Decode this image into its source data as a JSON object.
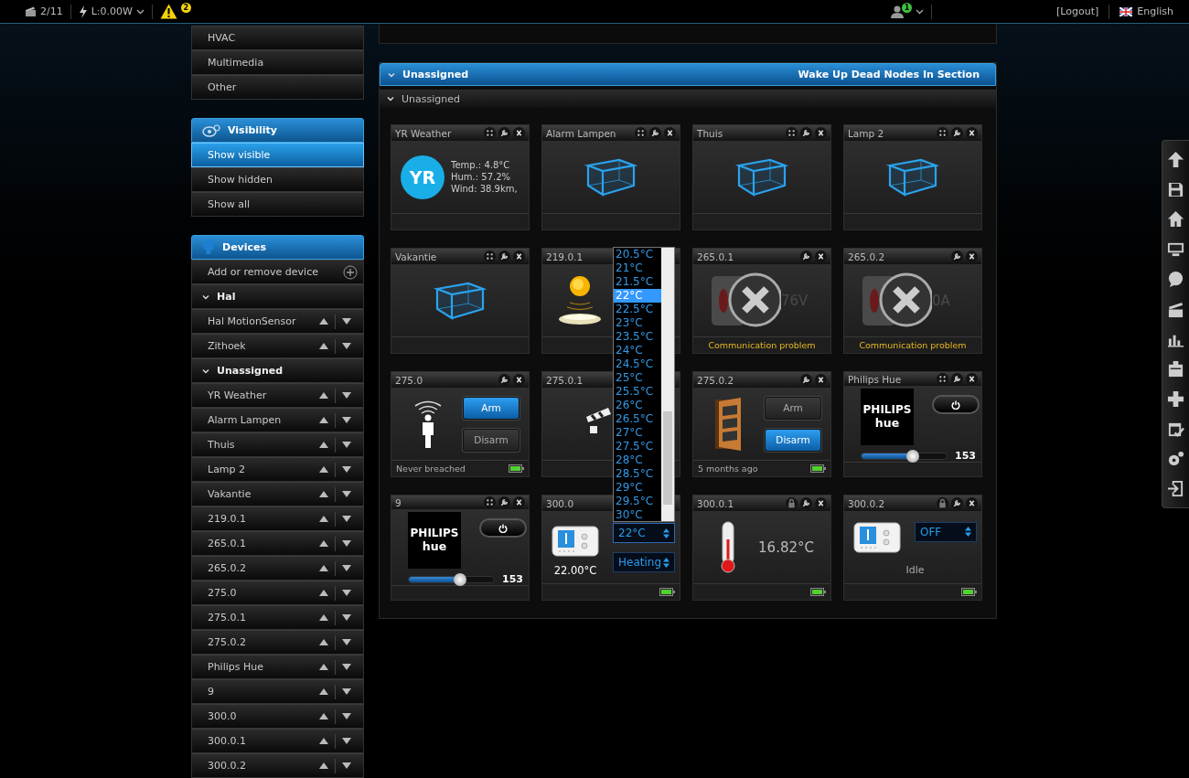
{
  "top_bar": {
    "scenes": "2/11",
    "power": "L:0.00W",
    "alerts": "2",
    "users": "1",
    "logout": "[Logout]",
    "language": "English"
  },
  "sidebar": {
    "menu": [
      {
        "label": "HVAC"
      },
      {
        "label": "Multimedia"
      },
      {
        "label": "Other"
      }
    ],
    "visibility": {
      "title": "Visibility",
      "items": [
        {
          "label": "Show visible",
          "selected": true
        },
        {
          "label": "Show hidden",
          "selected": false
        },
        {
          "label": "Show all",
          "selected": false
        }
      ]
    },
    "devices": {
      "title": "Devices",
      "add": "Add or remove device",
      "tree": [
        {
          "label": "Hal",
          "expanded": true,
          "children": [
            {
              "label": "Hal MotionSensor"
            },
            {
              "label": "Zithoek"
            }
          ]
        },
        {
          "label": "Unassigned",
          "expanded": true,
          "children": [
            {
              "label": "YR Weather"
            },
            {
              "label": "Alarm Lampen"
            },
            {
              "label": "Thuis"
            },
            {
              "label": "Lamp 2"
            },
            {
              "label": "Vakantie"
            },
            {
              "label": "219.0.1"
            },
            {
              "label": "265.0.1"
            },
            {
              "label": "265.0.2"
            },
            {
              "label": "275.0"
            },
            {
              "label": "275.0.1"
            },
            {
              "label": "275.0.2"
            },
            {
              "label": "Philips Hue"
            },
            {
              "label": "9"
            },
            {
              "label": "300.0"
            },
            {
              "label": "300.0.1"
            },
            {
              "label": "300.0.2"
            }
          ]
        }
      ]
    }
  },
  "panel": {
    "title": "Unassigned",
    "expanded": true,
    "action": "Wake Up Dead Nodes In Section",
    "subsection": {
      "label": "Unassigned",
      "expanded": true
    },
    "cards": [
      {
        "title": "YR Weather",
        "kind": "weather",
        "buttons": [
          {
            "kind": "move"
          },
          {
            "kind": "settings"
          },
          {
            "kind": "close"
          }
        ],
        "logo": "YR",
        "lines": [
          "Temp.: 4.8°C",
          "Hum.: 57.2%",
          "Wind: 38.9km,"
        ]
      },
      {
        "title": "Alarm Lampen",
        "kind": "scene",
        "buttons": [
          {
            "kind": "move"
          },
          {
            "kind": "settings"
          },
          {
            "kind": "close"
          }
        ]
      },
      {
        "title": "Thuis",
        "kind": "scene",
        "buttons": [
          {
            "kind": "move"
          },
          {
            "kind": "settings"
          },
          {
            "kind": "close"
          }
        ]
      },
      {
        "title": "Lamp 2",
        "kind": "scene",
        "buttons": [
          {
            "kind": "move"
          },
          {
            "kind": "settings"
          },
          {
            "kind": "close"
          }
        ]
      },
      {
        "title": "Vakantie",
        "kind": "scene",
        "buttons": [
          {
            "kind": "move"
          },
          {
            "kind": "settings"
          },
          {
            "kind": "close"
          }
        ]
      },
      {
        "title": "219.0.1",
        "kind": "light"
      },
      {
        "title": "265.0.1",
        "kind": "fault",
        "buttons": [
          {
            "kind": "settings"
          },
          {
            "kind": "close"
          }
        ],
        "reading": "76V",
        "status": "Communication problem"
      },
      {
        "title": "265.0.2",
        "kind": "fault",
        "buttons": [
          {
            "kind": "settings"
          },
          {
            "kind": "close"
          }
        ],
        "reading": "0A",
        "status": "Communication problem"
      },
      {
        "title": "275.0",
        "kind": "motion",
        "buttons": [
          {
            "kind": "settings"
          },
          {
            "kind": "close"
          }
        ],
        "actions": [
          {
            "label": "Arm",
            "selected": true
          },
          {
            "label": "Disarm",
            "selected": false
          }
        ],
        "footer": "Never breached",
        "battery": true
      },
      {
        "title": "275.0.1",
        "kind": "video"
      },
      {
        "title": "275.0.2",
        "kind": "door",
        "buttons": [
          {
            "kind": "settings"
          },
          {
            "kind": "close"
          }
        ],
        "actions": [
          {
            "label": "Arm",
            "selected": false
          },
          {
            "label": "Disarm",
            "selected": true
          }
        ],
        "footer": "5 months ago",
        "battery": true
      },
      {
        "title": "Philips Hue",
        "kind": "hue",
        "buttons": [
          {
            "kind": "move"
          },
          {
            "kind": "settings"
          },
          {
            "kind": "close"
          }
        ],
        "logo": [
          "PHILIPS",
          "hue"
        ],
        "level": 0.6,
        "value": "153"
      },
      {
        "title": "9",
        "kind": "hue",
        "buttons": [
          {
            "kind": "move"
          },
          {
            "kind": "settings"
          },
          {
            "kind": "close"
          }
        ],
        "logo": [
          "PHILIPS",
          "hue"
        ],
        "level": 0.6,
        "value": "153"
      },
      {
        "title": "300.0",
        "kind": "thermostat",
        "temperature": "22.00°C",
        "setpoint": {
          "value": "22°C",
          "open": true,
          "options": [
            {
              "label": "20.5°C",
              "selected": false
            },
            {
              "label": "21°C",
              "selected": false
            },
            {
              "label": "21.5°C",
              "selected": false
            },
            {
              "label": "22°C",
              "selected": true
            },
            {
              "label": "22.5°C",
              "selected": false
            },
            {
              "label": "23°C",
              "selected": false
            },
            {
              "label": "23.5°C",
              "selected": false
            },
            {
              "label": "24°C",
              "selected": false
            },
            {
              "label": "24.5°C",
              "selected": false
            },
            {
              "label": "25°C",
              "selected": false
            },
            {
              "label": "25.5°C",
              "selected": false
            },
            {
              "label": "26°C",
              "selected": false
            },
            {
              "label": "26.5°C",
              "selected": false
            },
            {
              "label": "27°C",
              "selected": false
            },
            {
              "label": "27.5°C",
              "selected": false
            },
            {
              "label": "28°C",
              "selected": false
            },
            {
              "label": "28.5°C",
              "selected": false
            },
            {
              "label": "29°C",
              "selected": false
            },
            {
              "label": "29.5°C",
              "selected": false
            },
            {
              "label": "30°C",
              "selected": false
            }
          ]
        },
        "mode": "Heating",
        "battery": true
      },
      {
        "title": "300.0.1",
        "kind": "thermometer",
        "buttons": [
          {
            "kind": "lock"
          },
          {
            "kind": "settings"
          },
          {
            "kind": "close"
          }
        ],
        "temperature": "16.82°C",
        "battery": true
      },
      {
        "title": "300.0.2",
        "kind": "mode",
        "buttons": [
          {
            "kind": "lock"
          },
          {
            "kind": "settings"
          },
          {
            "kind": "close"
          }
        ],
        "mode": "OFF",
        "status": "Idle",
        "battery": true
      }
    ]
  }
}
